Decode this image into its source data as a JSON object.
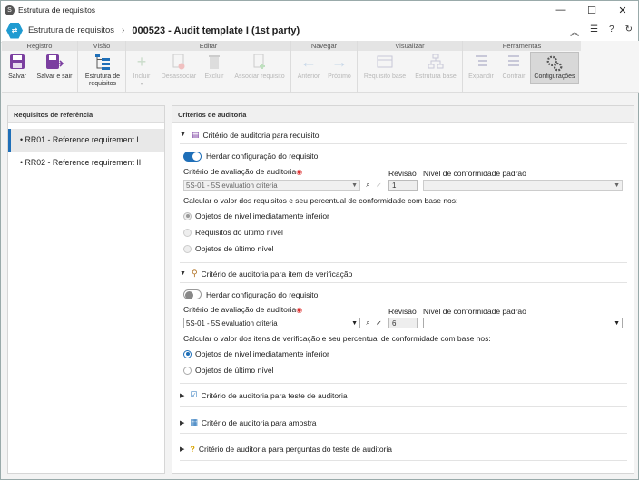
{
  "window": {
    "title": "Estrutura de requisitos"
  },
  "header": {
    "breadcrumb": "Estrutura de requisitos",
    "title": "000523 - Audit template I (1st party)"
  },
  "ribbon": {
    "groups": [
      "Registro",
      "Visão",
      "Editar",
      "Navegar",
      "Visualizar",
      "Ferramentas"
    ],
    "buttons": {
      "salvar": "Salvar",
      "salvar_sair": "Salvar e sair",
      "estrutura": "Estrutura de requisitos",
      "incluir": "Incluir",
      "desassociar": "Desassociar",
      "excluir": "Excluir",
      "associar": "Associar requisito",
      "anterior": "Anterior",
      "proximo": "Próximo",
      "req_base": "Requisito base",
      "estr_base": "Estrutura base",
      "expandir": "Expandir",
      "contrair": "Contrair",
      "config": "Configurações"
    }
  },
  "left": {
    "title": "Requisitos de referência",
    "items": [
      "RR01 - Reference requirement I",
      "RR02 - Reference requirement II"
    ]
  },
  "right": {
    "title": "Critérios de auditoria",
    "s1": {
      "title": "Critério de auditoria para requisito",
      "inherit": "Herdar configuração do requisito",
      "criteria_label": "Critério de avaliação de auditoria",
      "criteria_value": "5S-01 - 5S evaluation criteria",
      "rev_label": "Revisão",
      "rev_value": "1",
      "level_label": "Nível de conformidade padrão",
      "calc": "Calcular o valor dos requisitos e seu percentual de conformidade com base nos:",
      "opts": [
        "Objetos de nível imediatamente inferior",
        "Requisitos do último nível",
        "Objetos de último nível"
      ]
    },
    "s2": {
      "title": "Critério de auditoria para item de verificação",
      "inherit": "Herdar configuração do requisito",
      "criteria_label": "Critério de avaliação de auditoria",
      "criteria_value": "5S-01 - 5S evaluation criteria",
      "rev_label": "Revisão",
      "rev_value": "6",
      "level_label": "Nível de conformidade padrão",
      "calc": "Calcular o valor dos itens de verificação e seu percentual de conformidade com base nos:",
      "opts": [
        "Objetos de nível imediatamente inferior",
        "Objetos de último nível"
      ]
    },
    "s3": {
      "title": "Critério de auditoria para teste de auditoria"
    },
    "s4": {
      "title": "Critério de auditoria para amostra"
    },
    "s5": {
      "title": "Critério de auditoria para perguntas do teste de auditoria"
    }
  },
  "colors": {
    "accent": "#1f6fb8",
    "brand": "#1f9bd1"
  }
}
